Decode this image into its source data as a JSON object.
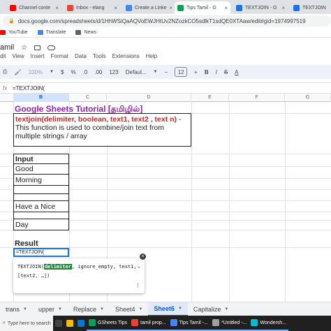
{
  "browser": {
    "tabs": [
      {
        "label": "Channel conte",
        "color": "#ff0000"
      },
      {
        "label": "Inbox - elang",
        "color": "#ea4335"
      },
      {
        "label": "Create a Linke",
        "color": "#4285f4"
      },
      {
        "label": "Tips Tamil - G",
        "color": "#0f9d58"
      },
      {
        "label": "TEXTJOIN - G",
        "color": "#1a73e8"
      },
      {
        "label": "TEXTJOIN",
        "color": "#1a73e8"
      }
    ],
    "url": "docs.google.com/spreadsheets/d/1HhWSiQaAQVoEWJHtUv2NZozkCO5sdlkT1sdQE0XTAaw/edit#gid=1974997519"
  },
  "bookmarks": [
    {
      "label": "YouTube",
      "color": "#ff0000"
    },
    {
      "label": "Translate",
      "color": "#4285f4"
    },
    {
      "label": "News",
      "color": "#5f6368"
    }
  ],
  "doc": {
    "title": "amil",
    "star": "☆",
    "menus": [
      "dit",
      "View",
      "Insert",
      "Format",
      "Data",
      "Tools",
      "Extensions",
      "Help"
    ]
  },
  "toolbar": {
    "zoom": "100%",
    "currency": "$",
    "percent": "%",
    "dec_dec": ".0",
    "dec_inc": ".00",
    "numfmt": "123",
    "font": "Defaul...",
    "font_size": "12",
    "bold": "B",
    "italic": "I",
    "strike": "S",
    "text_color": "A"
  },
  "formula_bar": {
    "fx": "fx",
    "value": "=TEXTJOIN("
  },
  "columns": [
    "B",
    "C",
    "D",
    "E",
    "F",
    "G"
  ],
  "sheet": {
    "title": "Google Sheets Tutorial [தமிழில்]",
    "signature": "textjoin(delimiter, boolean, text1, text2 , text n)",
    "description": " - This function is used to combine/join text from multiple strings / array",
    "input_header": "Input",
    "inputs": [
      "Good",
      "Morning",
      "",
      "Have a Nice",
      "",
      "Day"
    ],
    "result_label": "Result",
    "active_cell_value": "=TEXTJOIN("
  },
  "hint": {
    "fn": "TEXTJOIN(",
    "highlighted_arg": "delimiter",
    "rest_line1": ", ignore_empty, text1,",
    "line2": "[text2, …])",
    "close": "×",
    "expand": "⌄",
    "more": "⋮"
  },
  "sheet_tabs": [
    {
      "label": "trans",
      "active": false
    },
    {
      "label": "upper",
      "active": false
    },
    {
      "label": "Replace",
      "active": false
    },
    {
      "label": "Sheet4",
      "active": false
    },
    {
      "label": "Sheet6",
      "active": true
    },
    {
      "label": "Capitalize",
      "active": false
    }
  ],
  "taskbar": {
    "search_placeholder": "Type here to search",
    "apps": [
      {
        "label": "GSheets Tips",
        "color": "#0f9d58"
      },
      {
        "label": "tamil prop...",
        "color": "#ea4335"
      },
      {
        "label": "Tips Tamil -...",
        "color": "#4285f4"
      },
      {
        "label": "*Untitled -...",
        "color": "#9aa0a6"
      },
      {
        "label": "Wondersh...",
        "color": "#00bcd4"
      }
    ]
  }
}
